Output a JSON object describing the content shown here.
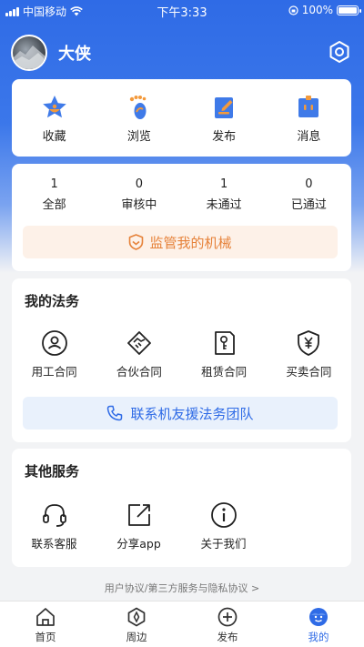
{
  "status_bar": {
    "carrier": "中国移动",
    "time": "下午3:33",
    "battery": "100%"
  },
  "profile": {
    "username": "大侠"
  },
  "quick_actions": [
    {
      "label": "收藏",
      "icon": "star-icon"
    },
    {
      "label": "浏览",
      "icon": "footprint-icon"
    },
    {
      "label": "发布",
      "icon": "edit-document-icon"
    },
    {
      "label": "消息",
      "icon": "message-icon"
    }
  ],
  "stats": [
    {
      "count": "1",
      "label": "全部"
    },
    {
      "count": "0",
      "label": "审核中"
    },
    {
      "count": "1",
      "label": "未通过"
    },
    {
      "count": "0",
      "label": "已通过"
    }
  ],
  "monitor_button": "监管我的机械",
  "legal": {
    "title": "我的法务",
    "items": [
      {
        "label": "用工合同",
        "icon": "user-contract-icon"
      },
      {
        "label": "合伙合同",
        "icon": "handshake-icon"
      },
      {
        "label": "租赁合同",
        "icon": "key-contract-icon"
      },
      {
        "label": "买卖合同",
        "icon": "yuan-shield-icon"
      }
    ],
    "contact_button": "联系机友援法务团队"
  },
  "services": {
    "title": "其他服务",
    "items": [
      {
        "label": "联系客服",
        "icon": "headset-icon"
      },
      {
        "label": "分享app",
        "icon": "share-icon"
      },
      {
        "label": "关于我们",
        "icon": "info-icon"
      }
    ]
  },
  "agreement_link": "用户协议/第三方服务与隐私协议 >",
  "tabs": [
    {
      "label": "首页",
      "icon": "home-icon",
      "active": false
    },
    {
      "label": "周边",
      "icon": "compass-icon",
      "active": false
    },
    {
      "label": "发布",
      "icon": "plus-circle-icon",
      "active": false
    },
    {
      "label": "我的",
      "icon": "profile-face-icon",
      "active": true
    }
  ],
  "colors": {
    "primary": "#2f6be6",
    "accent_orange": "#e6823a",
    "monitor_bg": "#fdf1e8",
    "contact_bg": "#e9f1fc"
  }
}
